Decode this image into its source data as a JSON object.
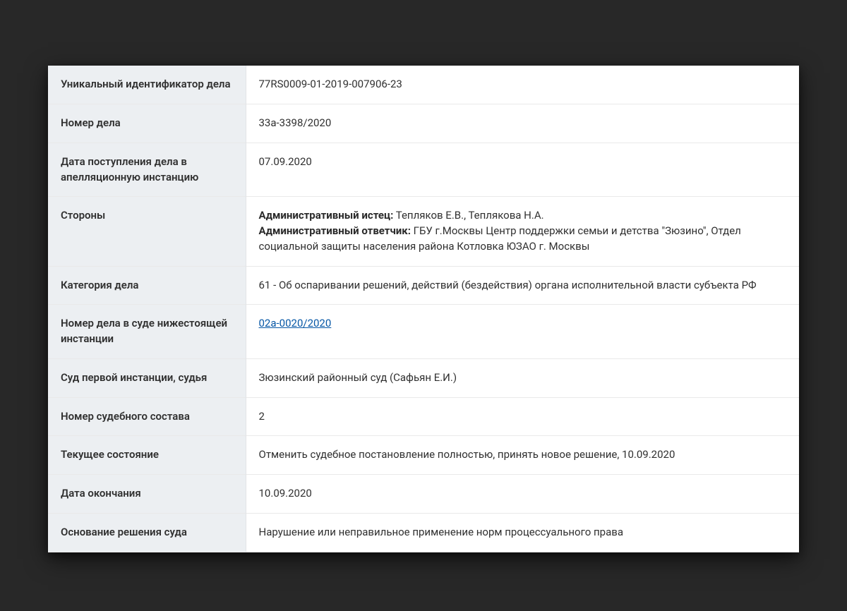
{
  "rows": [
    {
      "label": "Уникальный идентификатор дела",
      "value": "77RS0009-01-2019-007906-23"
    },
    {
      "label": "Номер дела",
      "value": "33а-3398/2020"
    },
    {
      "label": "Дата поступления дела в апелляционную инстанцию",
      "value": "07.09.2020"
    },
    {
      "label": "Стороны",
      "parties": [
        {
          "role": "Административный истец:",
          "names": "Тепляков Е.В., Теплякова Н.А."
        },
        {
          "role": "Административный ответчик:",
          "names": "ГБУ г.Москвы Центр поддержки семьи и детства \"Зюзино\", Отдел социальной защиты населения района Котловка ЮЗАО г. Москвы"
        }
      ]
    },
    {
      "label": "Категория дела",
      "value": "61 - Об оспаривании решений, действий (бездействия) органа исполнительной власти субъекта РФ"
    },
    {
      "label": "Номер дела в суде нижестоящей инстанции",
      "link": "02а-0020/2020"
    },
    {
      "label": "Суд первой инстанции, судья",
      "value": "Зюзинский районный суд (Сафьян Е.И.)"
    },
    {
      "label": "Номер судебного состава",
      "value": "2"
    },
    {
      "label": "Текущее состояние",
      "value": "Отменить судебное постановление полностью, принять новое решение, 10.09.2020"
    },
    {
      "label": "Дата окончания",
      "value": "10.09.2020"
    },
    {
      "label": "Основание решения суда",
      "value": "Нарушение или неправильное применение норм процессуального права"
    }
  ]
}
